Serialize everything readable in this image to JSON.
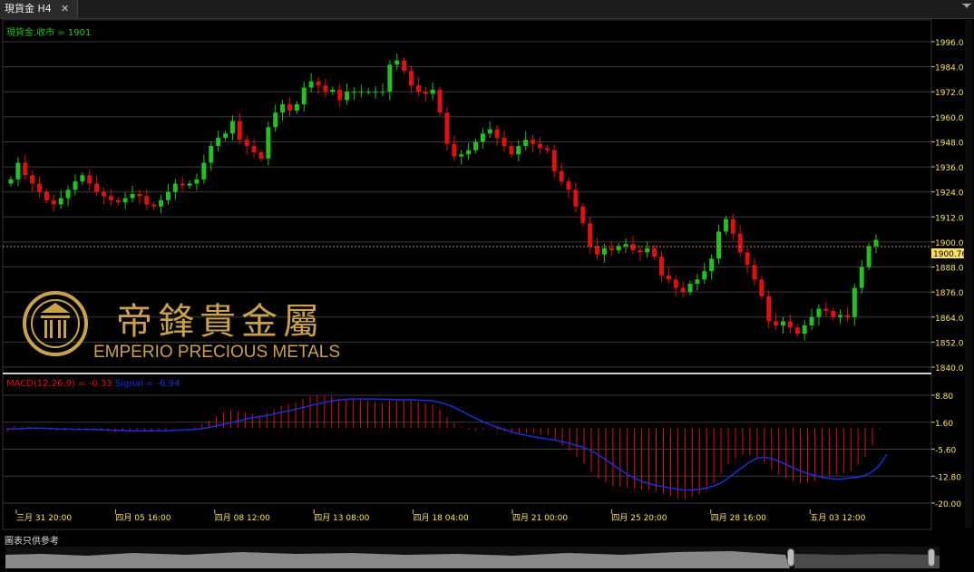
{
  "tab": {
    "title": "現貨金 H4",
    "close": "✕"
  },
  "price_label": "現貨金.收市 = 1901",
  "current_price_label": "1900.76",
  "macd_label": "MACD(12,26,9) = -0.33",
  "signal_label": "Signal = -6.94",
  "footer": "圖表只供參考",
  "logo": {
    "chinese": "帝鋒貴金屬",
    "english": "EMPERIO PRECIOUS METALS"
  },
  "colors": {
    "bull": "#22c022",
    "bear": "#e01010",
    "macd_hist": "#e01010",
    "signal": "#1a2fd8",
    "price_label": "#22c022",
    "axis_text": "#ffe066",
    "grid": "#3a3a3a"
  },
  "chart_data": [
    {
      "type": "candlestick",
      "title": "現貨金.收市 = 1901",
      "ylim": [
        1840,
        1996
      ],
      "y_ticks": [
        1996,
        1984,
        1972,
        1960,
        1948,
        1936,
        1924,
        1912,
        1900,
        1888,
        1876,
        1864,
        1852,
        1840
      ],
      "x_ticks": [
        "三月 31 20:00",
        "四月 05 16:00",
        "四月 08 12:00",
        "四月 13 08:00",
        "四月 18 04:00",
        "四月 21 00:00",
        "四月 25 20:00",
        "四月 28 16:00",
        "五月 03 12:00"
      ],
      "last_price": 1900.76,
      "close_path": [
        1930,
        1938,
        1932,
        1928,
        1924,
        1920,
        1918,
        1921,
        1925,
        1929,
        1932,
        1928,
        1924,
        1922,
        1920,
        1919,
        1921,
        1923,
        1922,
        1918,
        1917,
        1920,
        1924,
        1928,
        1927,
        1928,
        1930,
        1938,
        1946,
        1950,
        1952,
        1958,
        1949,
        1946,
        1943,
        1940,
        1955,
        1962,
        1966,
        1963,
        1966,
        1974,
        1977,
        1975,
        1972,
        1973,
        1968,
        1972,
        1972,
        1972,
        1972,
        1972,
        1972,
        1985,
        1987,
        1982,
        1975,
        1972,
        1971,
        1973,
        1962,
        1947,
        1941,
        1942,
        1944,
        1948,
        1952,
        1954,
        1950,
        1946,
        1942,
        1946,
        1949,
        1947,
        1945,
        1944,
        1934,
        1929,
        1925,
        1917,
        1909,
        1898,
        1894,
        1897,
        1896,
        1898,
        1899,
        1896,
        1895,
        1897,
        1893,
        1884,
        1882,
        1878,
        1876,
        1880,
        1882,
        1886,
        1892,
        1905,
        1911,
        1904,
        1895,
        1889,
        1882,
        1874,
        1862,
        1860,
        1862,
        1859,
        1856,
        1860,
        1864,
        1868,
        1867,
        1864,
        1865,
        1864,
        1878,
        1888,
        1898,
        1901
      ]
    },
    {
      "type": "bar",
      "title": "MACD(12,26,9) = -0.33",
      "ylim": [
        -20,
        8.8
      ],
      "y_ticks": [
        8.8,
        1.6,
        -5.6,
        -12.8,
        -20
      ],
      "series": [
        {
          "name": "MACD(12,26,9)",
          "values": [
            -1,
            0.5,
            0.2,
            0.5,
            0.3,
            -0.2,
            -0.5,
            -0.6,
            -0.6,
            -0.4,
            -0.2,
            -0.3,
            -0.5,
            -0.6,
            -0.8,
            -1,
            -0.9,
            -0.6,
            -0.4,
            -0.5,
            -0.8,
            -0.9,
            -0.6,
            -0.2,
            0,
            0.1,
            0.3,
            1,
            2,
            3.2,
            4.2,
            4.8,
            4.6,
            4.2,
            3.8,
            3.4,
            4.2,
            5.1,
            5.9,
            6.4,
            7,
            7.8,
            8.5,
            8.8,
            8.6,
            8.6,
            8,
            7.9,
            7.7,
            7.5,
            7.3,
            7,
            6.8,
            7.3,
            7.8,
            7.8,
            7.5,
            7.1,
            6.7,
            6.4,
            5,
            3,
            1.4,
            0.3,
            -0.5,
            -0.6,
            -0.4,
            -0.2,
            -0.4,
            -0.8,
            -1.3,
            -1.4,
            -1.3,
            -1.4,
            -1.6,
            -1.8,
            -3.2,
            -4.6,
            -6,
            -7.6,
            -9.4,
            -11.8,
            -13.5,
            -14.5,
            -15.3,
            -15.7,
            -15.9,
            -16.2,
            -16.4,
            -16.4,
            -16.7,
            -17.6,
            -18.1,
            -18.7,
            -19,
            -18.3,
            -17.6,
            -16.4,
            -14.7,
            -12.2,
            -9.4,
            -7.9,
            -7.1,
            -7.2,
            -7.8,
            -9.2,
            -11,
            -12.4,
            -13.3,
            -14.2,
            -14.7,
            -14.6,
            -14.1,
            -13.5,
            -12.8,
            -12.4,
            -12,
            -11.5,
            -9.8,
            -7.6,
            -4.6,
            -0.3
          ]
        },
        {
          "name": "Signal",
          "values": [
            -0.2,
            -0.2,
            -0.1,
            0,
            0,
            0,
            -0.1,
            -0.2,
            -0.2,
            -0.3,
            -0.3,
            -0.3,
            -0.3,
            -0.4,
            -0.5,
            -0.6,
            -0.6,
            -0.7,
            -0.7,
            -0.7,
            -0.7,
            -0.7,
            -0.7,
            -0.6,
            -0.5,
            -0.4,
            -0.3,
            -0.1,
            0.2,
            0.6,
            1,
            1.5,
            1.9,
            2.4,
            2.8,
            3.1,
            3.4,
            3.8,
            4.2,
            4.6,
            5.1,
            5.5,
            6,
            6.5,
            6.9,
            7.3,
            7.5,
            7.7,
            7.8,
            7.8,
            7.8,
            7.8,
            7.7,
            7.7,
            7.6,
            7.6,
            7.6,
            7.5,
            7.4,
            7.3,
            6.9,
            6.3,
            5.5,
            4.6,
            3.6,
            2.6,
            1.7,
            0.9,
            0.2,
            -0.4,
            -1,
            -1.5,
            -1.9,
            -2.3,
            -2.6,
            -2.9,
            -3.2,
            -3.6,
            -4.1,
            -4.6,
            -5.2,
            -6,
            -7.1,
            -8.4,
            -9.8,
            -11.1,
            -12.3,
            -13.3,
            -14.2,
            -14.8,
            -15.3,
            -15.6,
            -16,
            -16.3,
            -16.5,
            -16.5,
            -16.3,
            -16,
            -15.4,
            -14.6,
            -13.3,
            -11.8,
            -10.4,
            -9,
            -8,
            -7.7,
            -8.1,
            -8.8,
            -9.7,
            -10.6,
            -11.4,
            -12.1,
            -12.6,
            -13.1,
            -13.4,
            -13.6,
            -13.5,
            -13.3,
            -13.1,
            -12.6,
            -11.6,
            -9.8,
            -6.94
          ]
        }
      ]
    }
  ]
}
